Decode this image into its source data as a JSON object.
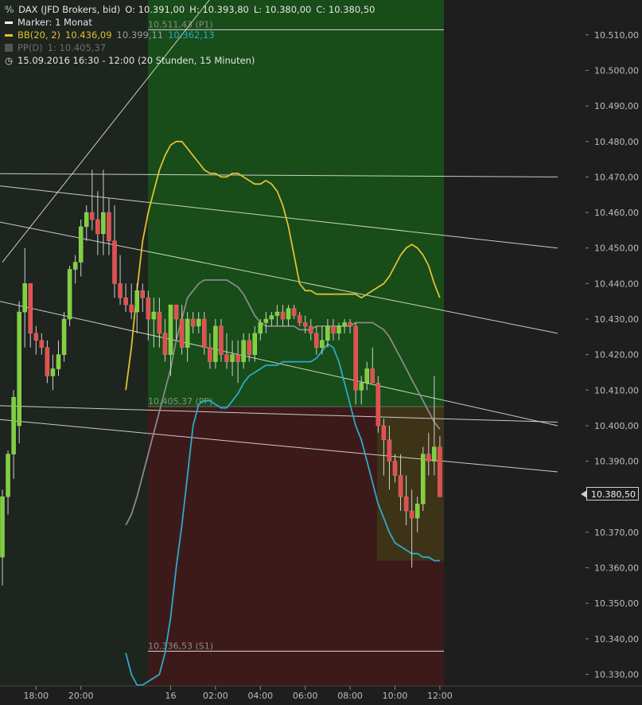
{
  "legend": {
    "title": "DAX (JFD Brokers, bid)",
    "o": "O: 10.391,00",
    "h": "H: 10.393,80",
    "l": "L: 10.380,00",
    "c": "C: 10.380,50",
    "marker": "Marker: 1 Monat",
    "bb_label": "BB(20, 2)",
    "bb_upper": "10.436,09",
    "bb_mid": "10.399,11",
    "bb_lower": "10.362,13",
    "pp_label": "PP(D)",
    "pp_value": "1: 10.405,37",
    "timeframe": "15.09.2016 16:30 - 12:00 (20 Stunden, 15 Minuten)"
  },
  "colors": {
    "background": "#1e1e1e",
    "bull": "#7fd040",
    "bear": "#e05050",
    "bb_upper": "#e0c030",
    "bb_mid": "#8a8a8a",
    "bb_lower": "#2fa9c8",
    "zone_green": "#184c18",
    "zone_red": "#3c1a1a",
    "zone_amber": "#3d3418"
  },
  "chart_data": {
    "type": "candlestick",
    "instrument": "DAX (JFD Brokers, bid)",
    "interval": "15 min",
    "ylim": [
      10325,
      10520
    ],
    "y_ticks": [
      "10.330,00",
      "10.340,00",
      "10.350,00",
      "10.360,00",
      "10.370,00",
      "10.380,00",
      "10.390,00",
      "10.400,00",
      "10.410,00",
      "10.420,00",
      "10.430,00",
      "10.440,00",
      "10.450,00",
      "10.460,00",
      "10.470,00",
      "10.480,00",
      "10.490,00",
      "10.500,00",
      "10.510,00"
    ],
    "y_tick_values": [
      10330,
      10340,
      10350,
      10360,
      10370,
      10380,
      10390,
      10400,
      10410,
      10420,
      10430,
      10440,
      10450,
      10460,
      10470,
      10480,
      10490,
      10500,
      10510
    ],
    "x_ticks": [
      {
        "label": "18:00",
        "t": 6
      },
      {
        "label": "20:00",
        "t": 14
      },
      {
        "label": "16",
        "t": 30
      },
      {
        "label": "02:00",
        "t": 38
      },
      {
        "label": "04:00",
        "t": 46
      },
      {
        "label": "06:00",
        "t": 54
      },
      {
        "label": "08:00",
        "t": 62
      },
      {
        "label": "10:00",
        "t": 70
      },
      {
        "label": "12:00",
        "t": 78
      }
    ],
    "candles": [
      [
        10363,
        10382,
        10355,
        10380
      ],
      [
        10380,
        10393,
        10375,
        10392
      ],
      [
        10392,
        10410,
        10385,
        10408
      ],
      [
        10400,
        10435,
        10395,
        10432
      ],
      [
        10432,
        10450,
        10422,
        10440
      ],
      [
        10440,
        10440,
        10422,
        10426
      ],
      [
        10426,
        10428,
        10420,
        10424
      ],
      [
        10424,
        10426,
        10420,
        10422
      ],
      [
        10422,
        10424,
        10412,
        10414
      ],
      [
        10414,
        10420,
        10410,
        10416
      ],
      [
        10416,
        10424,
        10414,
        10420
      ],
      [
        10420,
        10432,
        10418,
        10430
      ],
      [
        10430,
        10445,
        10428,
        10444
      ],
      [
        10444,
        10448,
        10440,
        10446
      ],
      [
        10446,
        10458,
        10442,
        10456
      ],
      [
        10456,
        10462,
        10452,
        10460
      ],
      [
        10460,
        10472,
        10455,
        10458
      ],
      [
        10458,
        10466,
        10448,
        10454
      ],
      [
        10454,
        10472,
        10448,
        10460
      ],
      [
        10460,
        10464,
        10448,
        10452
      ],
      [
        10452,
        10462,
        10436,
        10440
      ],
      [
        10440,
        10448,
        10434,
        10436
      ],
      [
        10436,
        10440,
        10432,
        10434
      ],
      [
        10434,
        10440,
        10430,
        10432
      ],
      [
        10432,
        10440,
        10426,
        10438
      ],
      [
        10438,
        10440,
        10432,
        10436
      ],
      [
        10436,
        10438,
        10424,
        10430
      ],
      [
        10430,
        10436,
        10422,
        10432
      ],
      [
        10432,
        10436,
        10422,
        10426
      ],
      [
        10426,
        10430,
        10418,
        10420
      ],
      [
        10420,
        10434,
        10414,
        10434
      ],
      [
        10434,
        10434,
        10424,
        10430
      ],
      [
        10430,
        10434,
        10420,
        10422
      ],
      [
        10422,
        10432,
        10418,
        10430
      ],
      [
        10430,
        10432,
        10426,
        10428
      ],
      [
        10428,
        10432,
        10426,
        10430
      ],
      [
        10430,
        10432,
        10420,
        10422
      ],
      [
        10422,
        10426,
        10416,
        10418
      ],
      [
        10418,
        10430,
        10416,
        10428
      ],
      [
        10428,
        10430,
        10418,
        10420
      ],
      [
        10420,
        10426,
        10416,
        10418
      ],
      [
        10418,
        10424,
        10414,
        10420
      ],
      [
        10420,
        10424,
        10412,
        10418
      ],
      [
        10418,
        10426,
        10416,
        10424
      ],
      [
        10424,
        10426,
        10418,
        10420
      ],
      [
        10420,
        10428,
        10418,
        10426
      ],
      [
        10426,
        10430,
        10424,
        10429
      ],
      [
        10429,
        10432,
        10426,
        10430
      ],
      [
        10430,
        10432,
        10428,
        10431
      ],
      [
        10431,
        10434,
        10428,
        10432
      ],
      [
        10432,
        10434,
        10428,
        10430
      ],
      [
        10430,
        10434,
        10428,
        10433
      ],
      [
        10433,
        10434,
        10430,
        10431
      ],
      [
        10431,
        10432,
        10428,
        10429
      ],
      [
        10429,
        10431,
        10426,
        10428
      ],
      [
        10428,
        10430,
        10424,
        10426
      ],
      [
        10426,
        10428,
        10420,
        10422
      ],
      [
        10422,
        10428,
        10420,
        10424
      ],
      [
        10424,
        10430,
        10422,
        10428
      ],
      [
        10428,
        10430,
        10424,
        10426
      ],
      [
        10426,
        10429,
        10424,
        10428
      ],
      [
        10428,
        10430,
        10426,
        10429
      ],
      [
        10429,
        10430,
        10426,
        10428
      ],
      [
        10428,
        10429,
        10406,
        10410
      ],
      [
        10410,
        10414,
        10406,
        10412
      ],
      [
        10412,
        10418,
        10410,
        10416
      ],
      [
        10416,
        10422,
        10412,
        10412
      ],
      [
        10412,
        10414,
        10398,
        10400
      ],
      [
        10400,
        10402,
        10386,
        10396
      ],
      [
        10396,
        10400,
        10382,
        10390
      ],
      [
        10390,
        10392,
        10384,
        10386
      ],
      [
        10386,
        10392,
        10376,
        10380
      ],
      [
        10380,
        10386,
        10372,
        10376
      ],
      [
        10376,
        10382,
        10360,
        10374
      ],
      [
        10374,
        10380,
        10370,
        10378
      ],
      [
        10378,
        10394,
        10376,
        10392
      ],
      [
        10392,
        10398,
        10386,
        10390
      ],
      [
        10390,
        10414,
        10386,
        10394
      ],
      [
        10394,
        10397,
        10384,
        10380
      ]
    ],
    "bb_upper_series": [
      10410,
      10422,
      10438,
      10452,
      10460,
      10466,
      10472,
      10476,
      10479,
      10480,
      10480,
      10478,
      10476,
      10474,
      10472,
      10471,
      10471,
      10470,
      10470,
      10471,
      10471,
      10470,
      10469,
      10468,
      10468,
      10469,
      10468,
      10466,
      10462,
      10456,
      10448,
      10440,
      10438,
      10438,
      10437,
      10437,
      10437,
      10437,
      10437,
      10437,
      10437,
      10437,
      10436,
      10437,
      10438,
      10439,
      10440,
      10442,
      10445,
      10448,
      10450,
      10451,
      10450,
      10448,
      10445,
      10440,
      10436
    ],
    "bb_mid_series": [
      10372,
      10375,
      10380,
      10386,
      10392,
      10398,
      10404,
      10410,
      10416,
      10424,
      10430,
      10436,
      10438,
      10440,
      10441,
      10441,
      10441,
      10441,
      10441,
      10440,
      10439,
      10437,
      10434,
      10431,
      10429,
      10428,
      10428,
      10428,
      10428,
      10428,
      10428,
      10427,
      10427,
      10427,
      10428,
      10428,
      10428,
      10428,
      10428,
      10428,
      10428,
      10429,
      10429,
      10429,
      10429,
      10428,
      10427,
      10425,
      10422,
      10419,
      10416,
      10413,
      10410,
      10407,
      10404,
      10401,
      10399
    ],
    "bb_lower_series": [
      10336,
      10330,
      10327,
      10327,
      10328,
      10329,
      10330,
      10336,
      10346,
      10360,
      10372,
      10386,
      10400,
      10406,
      10407,
      10407,
      10406,
      10405,
      10405,
      10407,
      10409,
      10412,
      10414,
      10415,
      10416,
      10417,
      10417,
      10417,
      10418,
      10418,
      10418,
      10418,
      10418,
      10418,
      10419,
      10421,
      10423,
      10422,
      10418,
      10412,
      10406,
      10400,
      10396,
      10390,
      10384,
      10378,
      10374,
      10370,
      10367,
      10366,
      10365,
      10364,
      10364,
      10363,
      10363,
      10362,
      10362
    ],
    "pivot_levels": [
      {
        "label": "10.511,43 (P1)",
        "value": 10511.43
      },
      {
        "label": "10.405,37 (PP)",
        "value": 10405.37
      },
      {
        "label": "10.336,53 (S1)",
        "value": 10336.53
      }
    ],
    "last_price": "10.380,50",
    "trendlines": [
      {
        "from": [
          -9,
          10471
        ],
        "to": [
          99,
          10470
        ]
      },
      {
        "from": [
          -9,
          10469
        ],
        "to": [
          99,
          10450
        ]
      },
      {
        "from": [
          -9,
          10460
        ],
        "to": [
          99,
          10426
        ]
      },
      {
        "from": [
          -9,
          10438
        ],
        "to": [
          99,
          10400
        ]
      },
      {
        "from": [
          -9,
          10406
        ],
        "to": [
          99,
          10401
        ]
      },
      {
        "from": [
          -9,
          10403
        ],
        "to": [
          99,
          10387
        ]
      },
      {
        "from": [
          0,
          10446
        ],
        "to": [
          40,
          10526
        ]
      }
    ]
  }
}
